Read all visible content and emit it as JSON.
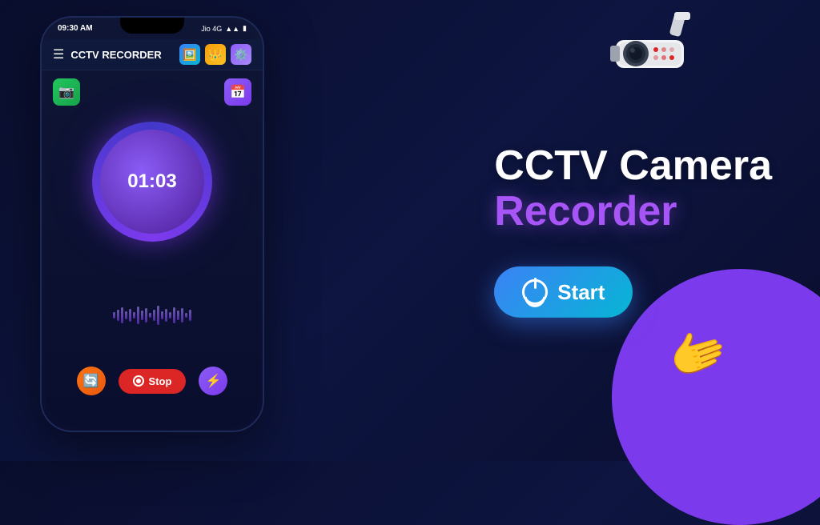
{
  "background": {
    "gradient_start": "#0a0e2e",
    "gradient_end": "#0d1540"
  },
  "phone": {
    "status_bar": {
      "time": "09:30 AM",
      "carrier": "Jio 4G"
    },
    "app_bar": {
      "title": "CCTV RECORDER",
      "icon_gallery": "🖼️",
      "icon_crown": "👑",
      "icon_settings": "⚙️"
    },
    "top_buttons": {
      "camera_icon": "📷",
      "schedule_icon": "📅"
    },
    "timer": {
      "value": "01:03"
    },
    "bottom_controls": {
      "rotate_icon": "🔄",
      "stop_label": "Stop",
      "flash_icon": "⚡"
    }
  },
  "right_section": {
    "title_line1": "CCTV Camera",
    "title_line2": "Recorder",
    "start_button_label": "Start"
  },
  "colors": {
    "accent_purple": "#a855f7",
    "accent_blue": "#3b82f6",
    "accent_cyan": "#06b6d4",
    "stop_red": "#dc2626",
    "timer_purple": "#7c3aed"
  }
}
